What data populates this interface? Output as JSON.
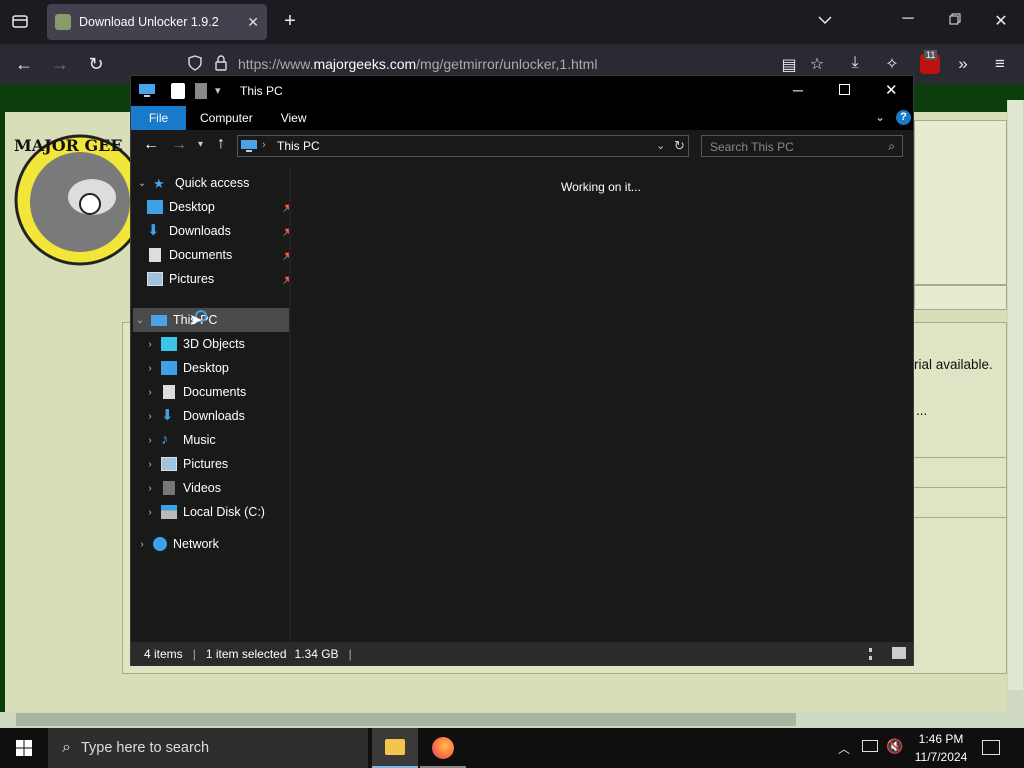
{
  "browser": {
    "tab_title": "Download Unlocker 1.9.2",
    "url_prefix": "https://www.",
    "url_domain": "majorgeeks.com",
    "url_path": "/mg/getmirror/unlocker,1.html",
    "extension_badge": "11"
  },
  "site": {
    "logo_text": "MAJOR GEE",
    "fragment_1": "rial available.",
    "fragment_2": "..."
  },
  "explorer": {
    "title": "This PC",
    "ribbon": {
      "file": "File",
      "computer": "Computer",
      "view": "View"
    },
    "address": "This PC",
    "search_placeholder": "Search This PC",
    "content_message": "Working on it...",
    "tree": {
      "quick_access": "Quick access",
      "quick_items": [
        "Desktop",
        "Downloads",
        "Documents",
        "Pictures"
      ],
      "this_pc": "This PC",
      "pc_items": [
        "3D Objects",
        "Desktop",
        "Documents",
        "Downloads",
        "Music",
        "Pictures",
        "Videos",
        "Local Disk (C:)"
      ],
      "network": "Network"
    },
    "status": {
      "items": "4 items",
      "selected": "1 item selected",
      "size": "1.34 GB"
    }
  },
  "taskbar": {
    "search_placeholder": "Type here to search",
    "time": "1:46 PM",
    "date": "11/7/2024"
  },
  "colors": {
    "accent": "#1979ca",
    "site_green": "#0d3d0d"
  }
}
